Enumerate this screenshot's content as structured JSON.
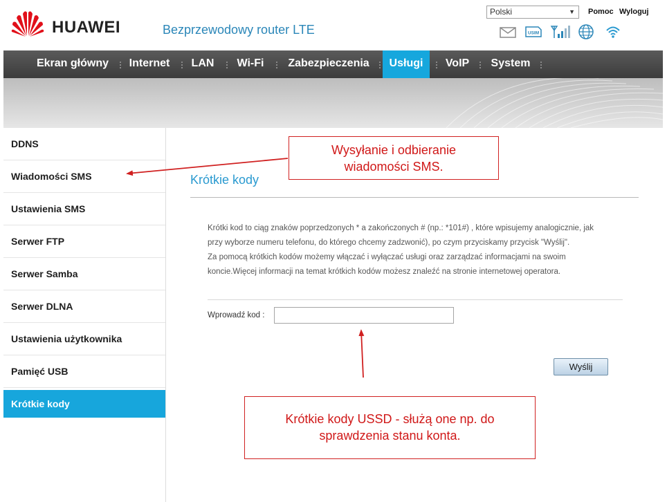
{
  "header": {
    "brand": "HUAWEI",
    "product_name": "Bezprzewodowy router LTE",
    "language": {
      "selected": "Polski"
    },
    "help_label": "Pomoc",
    "logout_label": "Wyloguj",
    "status_icons": [
      "mail-icon",
      "usim-icon",
      "signal-strength-icon",
      "internet-globe-icon",
      "wifi-icon"
    ],
    "usim_label": "USIM"
  },
  "nav": {
    "items": [
      {
        "label": "Ekran główny"
      },
      {
        "label": "Internet"
      },
      {
        "label": "LAN"
      },
      {
        "label": "Wi-Fi"
      },
      {
        "label": "Zabezpieczenia"
      },
      {
        "label": "Usługi",
        "active": true
      },
      {
        "label": "VoIP"
      },
      {
        "label": "System"
      }
    ]
  },
  "sidebar": {
    "items": [
      {
        "label": "DDNS"
      },
      {
        "label": "Wiadomości SMS"
      },
      {
        "label": "Ustawienia SMS"
      },
      {
        "label": "Serwer FTP"
      },
      {
        "label": "Serwer Samba"
      },
      {
        "label": "Serwer DLNA"
      },
      {
        "label": "Ustawienia użytkownika"
      },
      {
        "label": "Pamięć USB"
      },
      {
        "label": "Krótkie kody",
        "active": true
      }
    ]
  },
  "main": {
    "title": "Krótkie kody",
    "description": {
      "line1": "Krótki kod to ciąg znaków poprzedzonych * a zakończonych # (np.: *101#) , które wpisujemy analogicznie, jak",
      "line2": "przy wyborze numeru telefonu, do którego chcemy zadzwonić), po czym przyciskamy przycisk \"Wyślij\".",
      "line3": "Za pomocą krótkich kodów możemy włączać i wyłączać usługi oraz zarządzać informacjami na swoim",
      "line4": "koncie.Więcej informacji na temat krótkich kodów możesz znaleźć na stronie internetowej operatora."
    },
    "code_label": "Wprowadź kod :",
    "code_value": "",
    "send_label": "Wyślij"
  },
  "annotations": {
    "sms_callout": {
      "line1": "Wysyłanie i odbieranie",
      "line2": "wiadomości SMS."
    },
    "ussd_callout": {
      "line1": "Krótkie kody USSD - służą one np. do",
      "line2": "sprawdzenia stanu konta."
    }
  },
  "colors": {
    "accent": "#16a7dd",
    "nav_background": "#484848",
    "annotation_red": "#d02020",
    "title_blue": "#2a9ad0"
  }
}
